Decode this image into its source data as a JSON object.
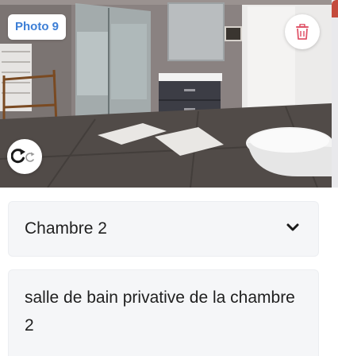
{
  "photo": {
    "badge_label": "Photo 9"
  },
  "controls": {
    "delete_icon": "trash-icon",
    "rotate_icon": "rotate-icon",
    "accent_color": "#3d7fd6",
    "delete_color": "#e0566a"
  },
  "room_select": {
    "selected_value": "Chambre 2",
    "icon": "chevron-down-icon"
  },
  "description": {
    "value": "salle de bain privative de la chambre 2"
  }
}
